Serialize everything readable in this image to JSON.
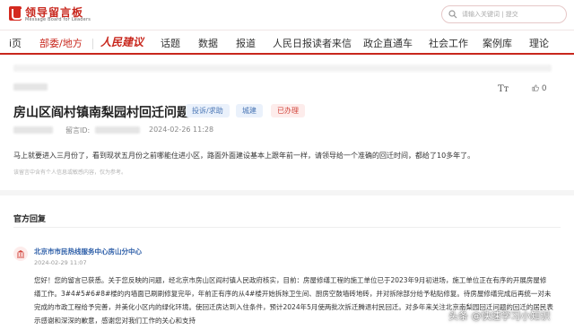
{
  "header": {
    "logo_title": "领导留言板",
    "logo_subtitle": "Message Board for Leaders",
    "search_placeholder": "请输入关键词 | 提交"
  },
  "nav": {
    "items": [
      {
        "label": "首页",
        "display": "i页"
      },
      {
        "label": "部委/地方",
        "active": true
      },
      {
        "label": "人民建议",
        "brand": true
      },
      {
        "label": "话题"
      },
      {
        "label": "数据"
      },
      {
        "label": "报道"
      },
      {
        "label": "人民日报读者来信"
      },
      {
        "label": "政企直通车"
      },
      {
        "label": "社会工作"
      },
      {
        "label": "案例库"
      },
      {
        "label": "理论"
      }
    ]
  },
  "post": {
    "font_size_icon": "Tт",
    "like_count": "0",
    "title": "房山区阎村镇南梨园村回迁问题",
    "tags": [
      "投诉/求助",
      "城建",
      "已办理"
    ],
    "message_id_label": "留言ID:",
    "date": "2024-02-26 11:28",
    "body": "马上就要进入三月份了，看到现状五月份之前哪能住进小区，路面外面建设基本上跟年前一样，请领导给一个准确的回迁时间，都给了10多年了。",
    "disclaimer": "该留言中含有个人信息或敏感内容，仅为参考。"
  },
  "reply": {
    "section_title": "官方回复",
    "org_name": "北京市市民热线服务中心房山分中心",
    "date": "2024-02-29 11:07",
    "lines": [
      "您好！您的留言已获悉。关于您反映的问题，经北京市房山区阎村镇人民政府核实，目前：房屋修缮工程的施工单位已于2023年9月初进场，施工单位正在有序的开展房屋修",
      "缮工作。3#4#5#6#8#楼的内墙面已刷刷修复完毕，年前正有序的从4#楼开始拆除卫生间、厨房空鼓墙砖地砖，并对拆除部分给予粘贴修复。待房屋修缮完成后再统一对未",
      "完成的市政工程给予完善，并美化小区内的绿化环境。使回迁房达到入住条件，预计2024年5月使两批次拆迁腾退村民回迁。对多年来关注北京南梨园回迁问题的回迁的居民表",
      "示感谢和深深的歉意，感谢您对我们工作的关心和支持"
    ]
  },
  "watermark": "头条 @快速学习小知识",
  "colors": {
    "brand_red": "#c8271d",
    "link_blue": "#2d5ea8",
    "tag_blue_bg": "#eaf1fb",
    "tag_red_bg": "#fdeceb"
  },
  "icons": {
    "logo": "logo-icon",
    "search": "search-icon",
    "font": "font-size-icon",
    "like": "thumbs-up-icon",
    "org": "government-building-icon"
  }
}
